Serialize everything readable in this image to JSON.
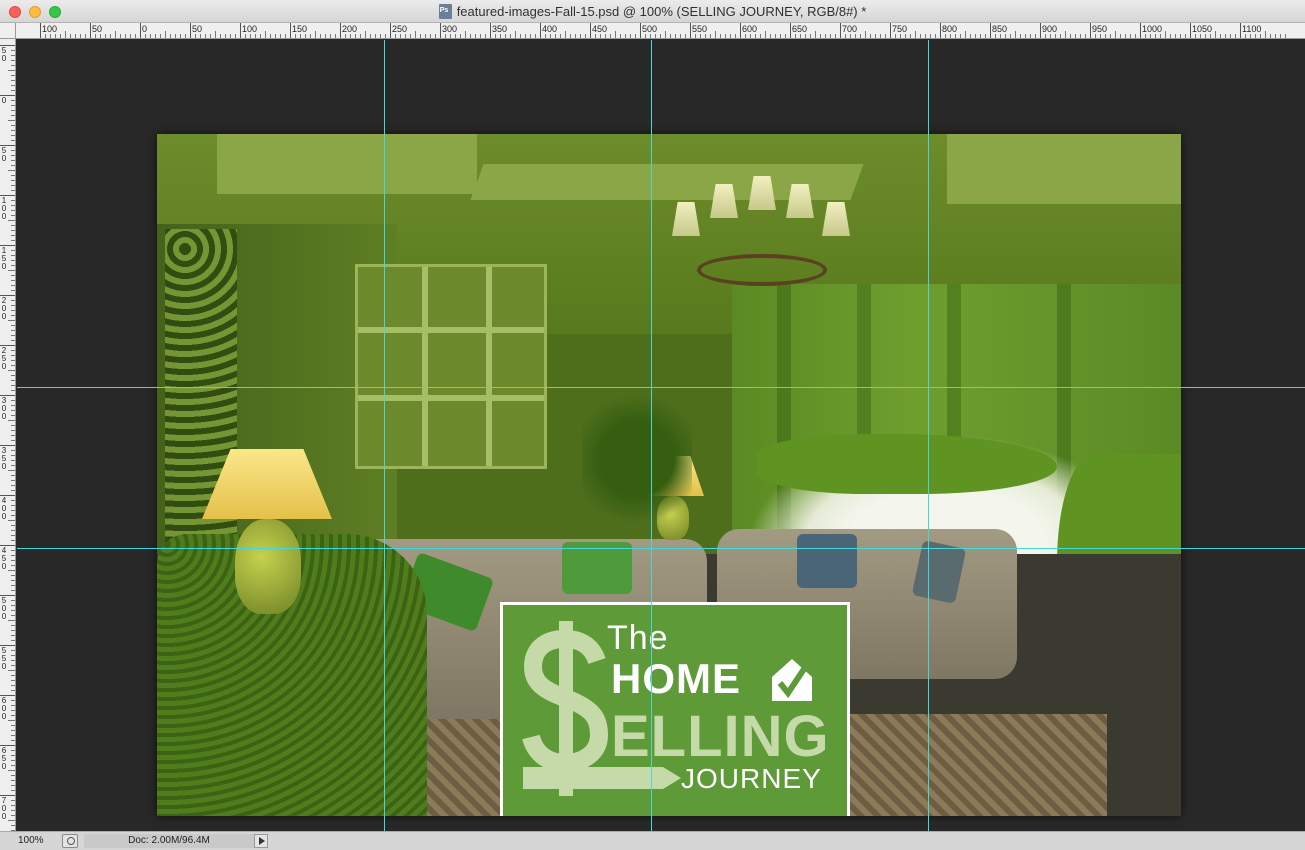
{
  "window": {
    "title": "featured-images-Fall-15.psd @ 100% (SELLING JOURNEY, RGB/8#) *",
    "controls": [
      "close",
      "minimize",
      "maximize"
    ]
  },
  "ruler_top": {
    "labels": [
      "100",
      "50",
      "0",
      "50",
      "100",
      "150",
      "200",
      "250",
      "300",
      "350",
      "400",
      "450",
      "500",
      "550",
      "600",
      "650",
      "700",
      "750",
      "800",
      "850",
      "900",
      "950",
      "1000",
      "1050",
      "1100"
    ]
  },
  "ruler_left": {
    "labels": [
      "50",
      "0",
      "50",
      "100",
      "150",
      "200",
      "250",
      "300",
      "350",
      "400",
      "450",
      "500",
      "550",
      "600",
      "650",
      "700"
    ]
  },
  "logo": {
    "line1": "The",
    "line2": "HOME",
    "line3": "ELLING",
    "line4": "JOURNEY",
    "primary_color": "#5f9a38",
    "accent_color": "#c6d9a8"
  },
  "statusbar": {
    "zoom": "100%",
    "doc_size": "Doc: 2.00M/96.4M"
  },
  "colors": {
    "guide": "#43d8dc",
    "pasteboard": "#282828",
    "overlay_green": "#5f9423"
  },
  "icons": {
    "document": "photoshop-document-icon",
    "status": "proof-setup-icon",
    "menu_arrow": "play-arrow-icon"
  }
}
